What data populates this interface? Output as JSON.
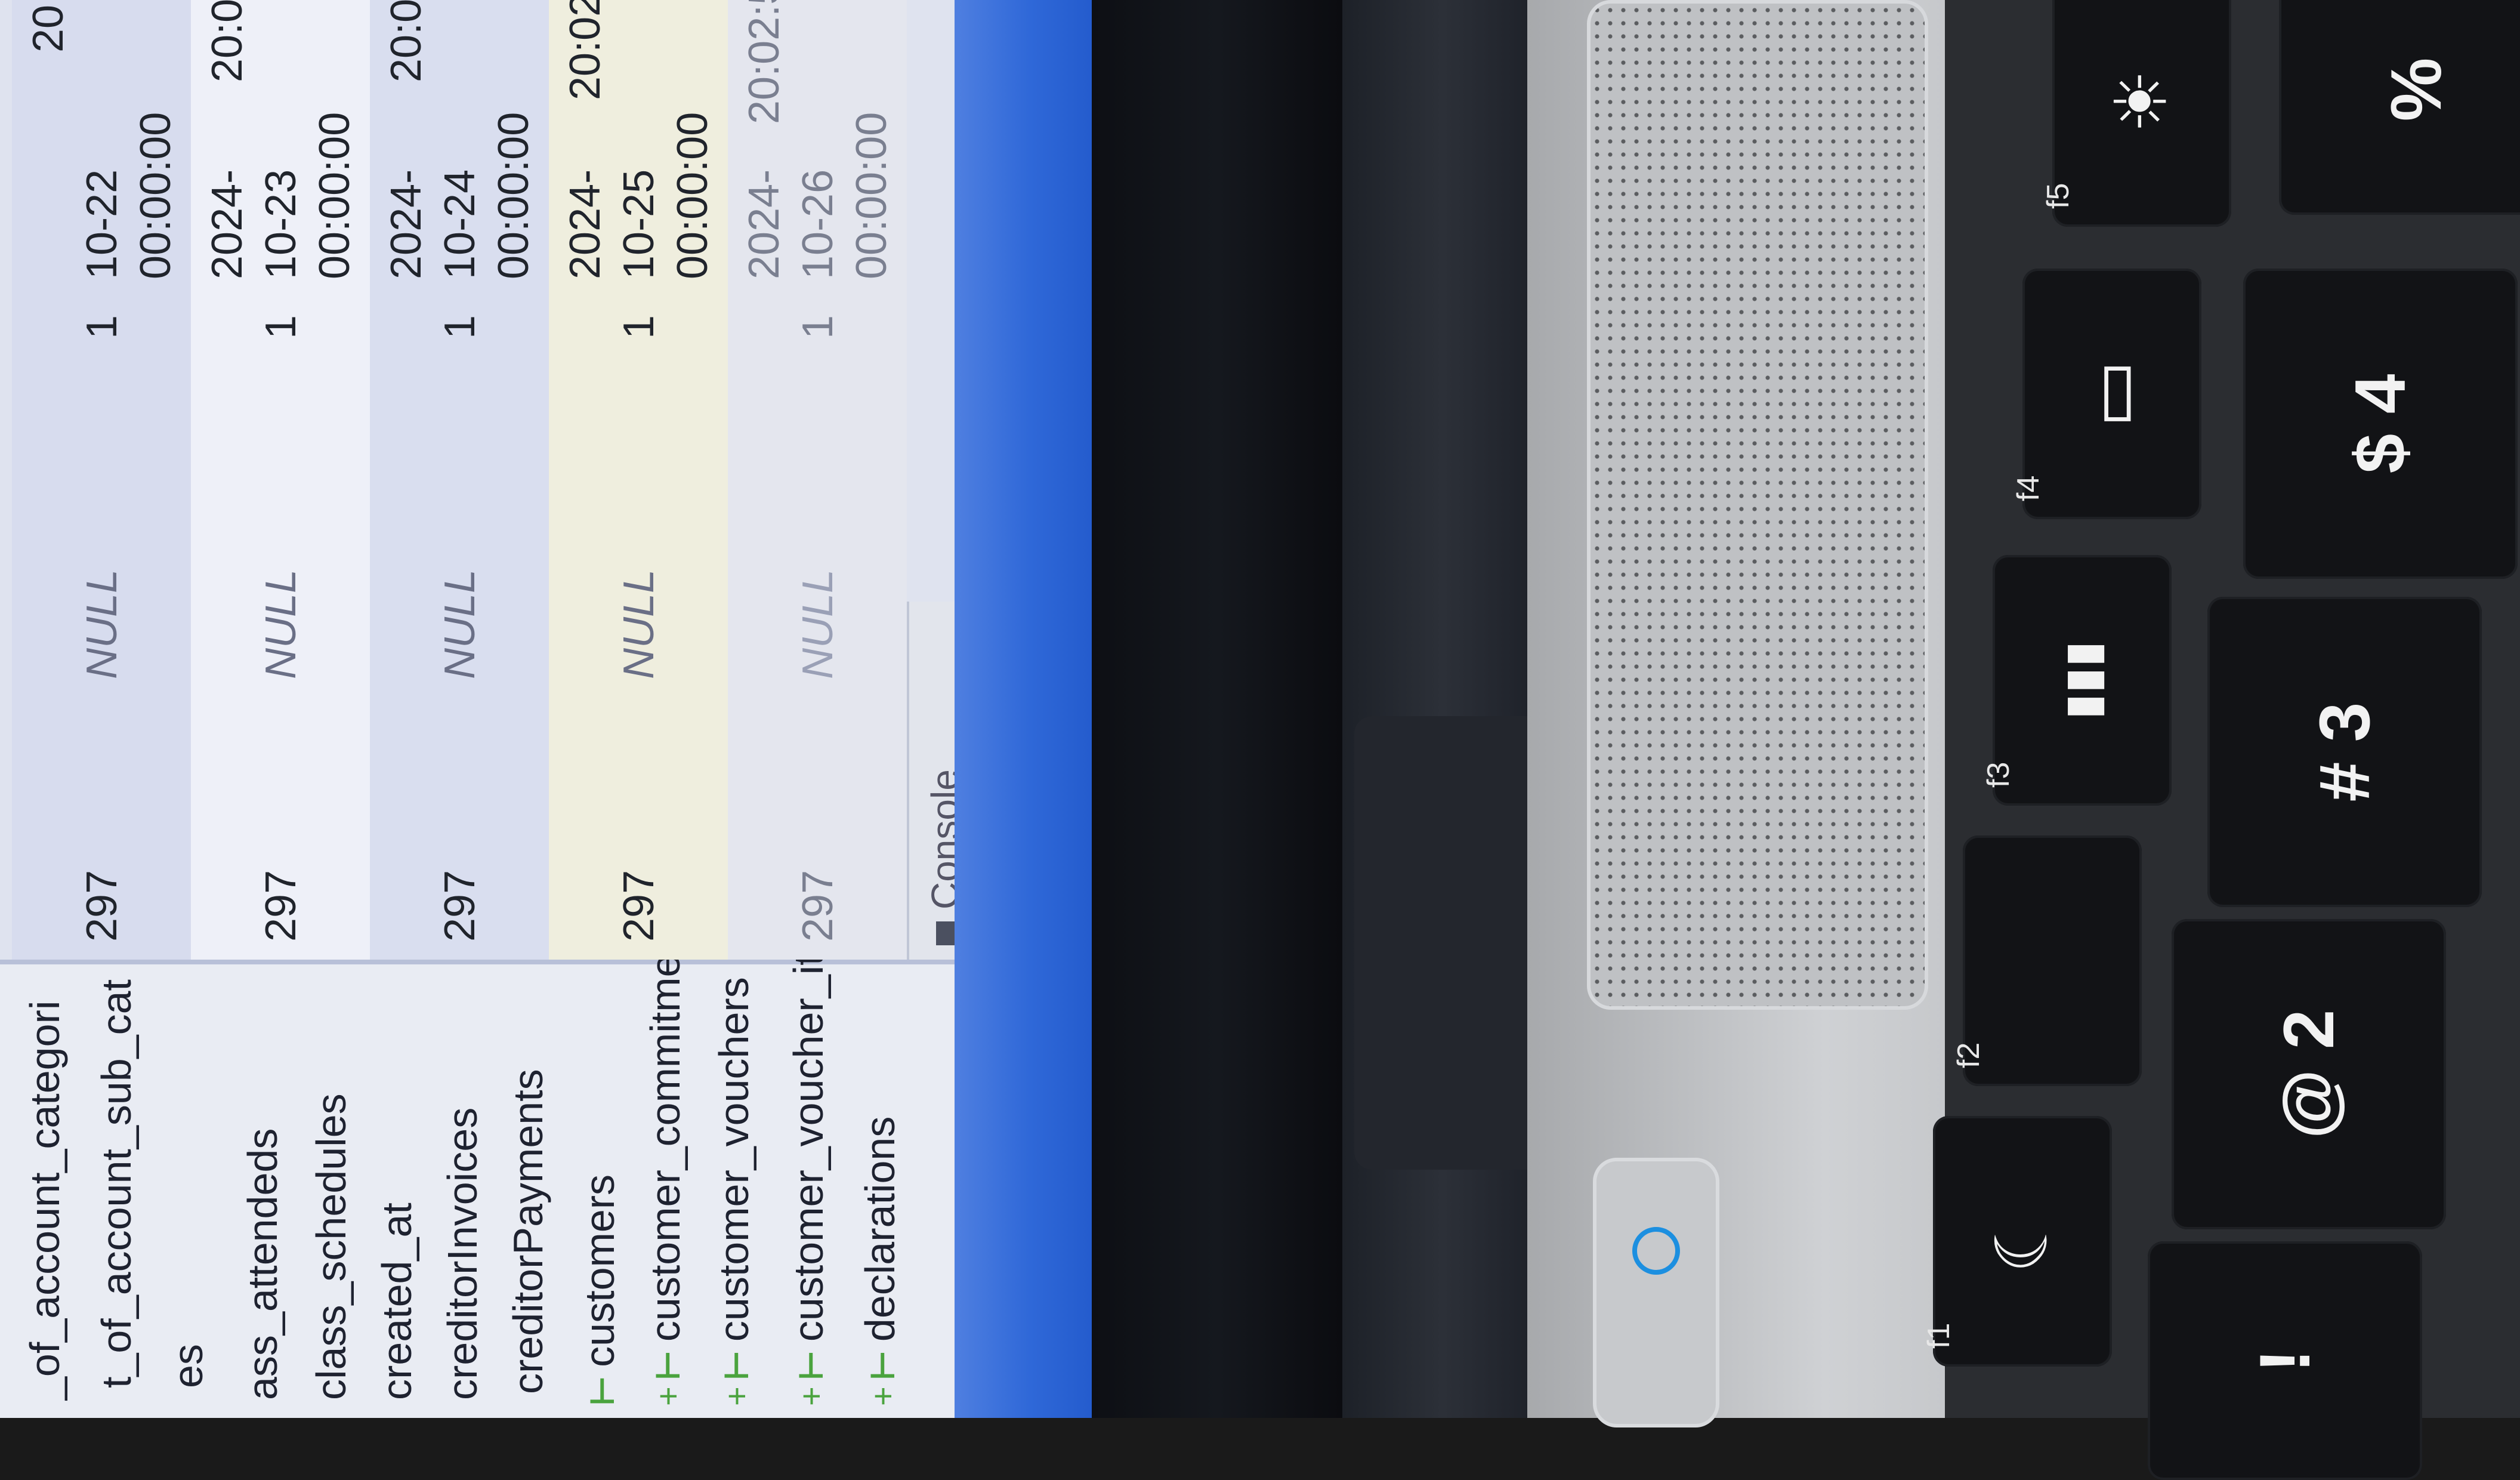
{
  "tree": {
    "items": [
      {
        "label": "_of_account_categori",
        "icon": "",
        "expand": ""
      },
      {
        "label": "t_of_account_sub_cat",
        "icon": "",
        "expand": ""
      },
      {
        "label": "es",
        "icon": "",
        "expand": ""
      },
      {
        "label": "ass_attendeds",
        "icon": "",
        "expand": ""
      },
      {
        "label": "class_schedules",
        "icon": "",
        "expand": ""
      },
      {
        "label": "created_at",
        "icon": "",
        "expand": ""
      },
      {
        "label": "creditorInvoices",
        "icon": "",
        "expand": ""
      },
      {
        "label": "creditorPayments",
        "icon": "",
        "expand": ""
      },
      {
        "label": "customers",
        "icon": "table-icon",
        "expand": ""
      },
      {
        "label": "customer_commitment_fee",
        "icon": "table-icon",
        "expand": "+"
      },
      {
        "label": "customer_vouchers",
        "icon": "table-icon",
        "expand": "+"
      },
      {
        "label": "customer_voucher_items",
        "icon": "table-icon",
        "expand": "+"
      },
      {
        "label": "declarations",
        "icon": "table-icon",
        "expand": "+"
      }
    ]
  },
  "grid": {
    "rows": [
      {
        "id": "297",
        "value": "NULL",
        "flag": "1",
        "date_year": "",
        "date_md": "10-22",
        "date_time": "00:00:00",
        "ts": "20"
      },
      {
        "id": "297",
        "value": "NULL",
        "flag": "1",
        "date_year": "2024-",
        "date_md": "10-23",
        "date_time": "00:00:00",
        "ts": "20:0"
      },
      {
        "id": "297",
        "value": "NULL",
        "flag": "1",
        "date_year": "2024-",
        "date_md": "10-24",
        "date_time": "00:00:00",
        "ts": "20:0"
      },
      {
        "id": "297",
        "value": "NULL",
        "flag": "1",
        "date_year": "2024-",
        "date_md": "10-25",
        "date_time": "00:00:00",
        "ts": "20:02"
      },
      {
        "id": "297",
        "value": "NULL",
        "flag": "1",
        "date_year": "2024-",
        "date_md": "10-26",
        "date_time": "00:00:00",
        "ts": "20:02:5"
      }
    ]
  },
  "console": {
    "label": "Console"
  },
  "keyboard": {
    "keys": [
      {
        "name": "f1-key",
        "fn": "f1",
        "icon": "moon-icon",
        "glyph": "☾"
      },
      {
        "name": "f2-key",
        "fn": "f2",
        "icon": "",
        "glyph": ""
      },
      {
        "name": "f3-key",
        "fn": "f3",
        "icon": "keyboard-backlight-icon",
        "glyph": "▮▮▮"
      },
      {
        "name": "f4-key",
        "fn": "f4",
        "icon": "display-icon",
        "glyph": "▭"
      },
      {
        "name": "f5-key",
        "fn": "f5",
        "icon": "brightness-icon",
        "glyph": "☀"
      },
      {
        "name": "key-2",
        "fn": "",
        "icon": "",
        "glyph": "@ 2"
      },
      {
        "name": "key-3",
        "fn": "",
        "icon": "",
        "glyph": "# 3"
      },
      {
        "name": "key-4",
        "fn": "",
        "icon": "",
        "glyph": "$ 4"
      },
      {
        "name": "key-5",
        "fn": "",
        "icon": "",
        "glyph": "%"
      },
      {
        "name": "key-1",
        "fn": "",
        "icon": "",
        "glyph": "!"
      }
    ]
  }
}
